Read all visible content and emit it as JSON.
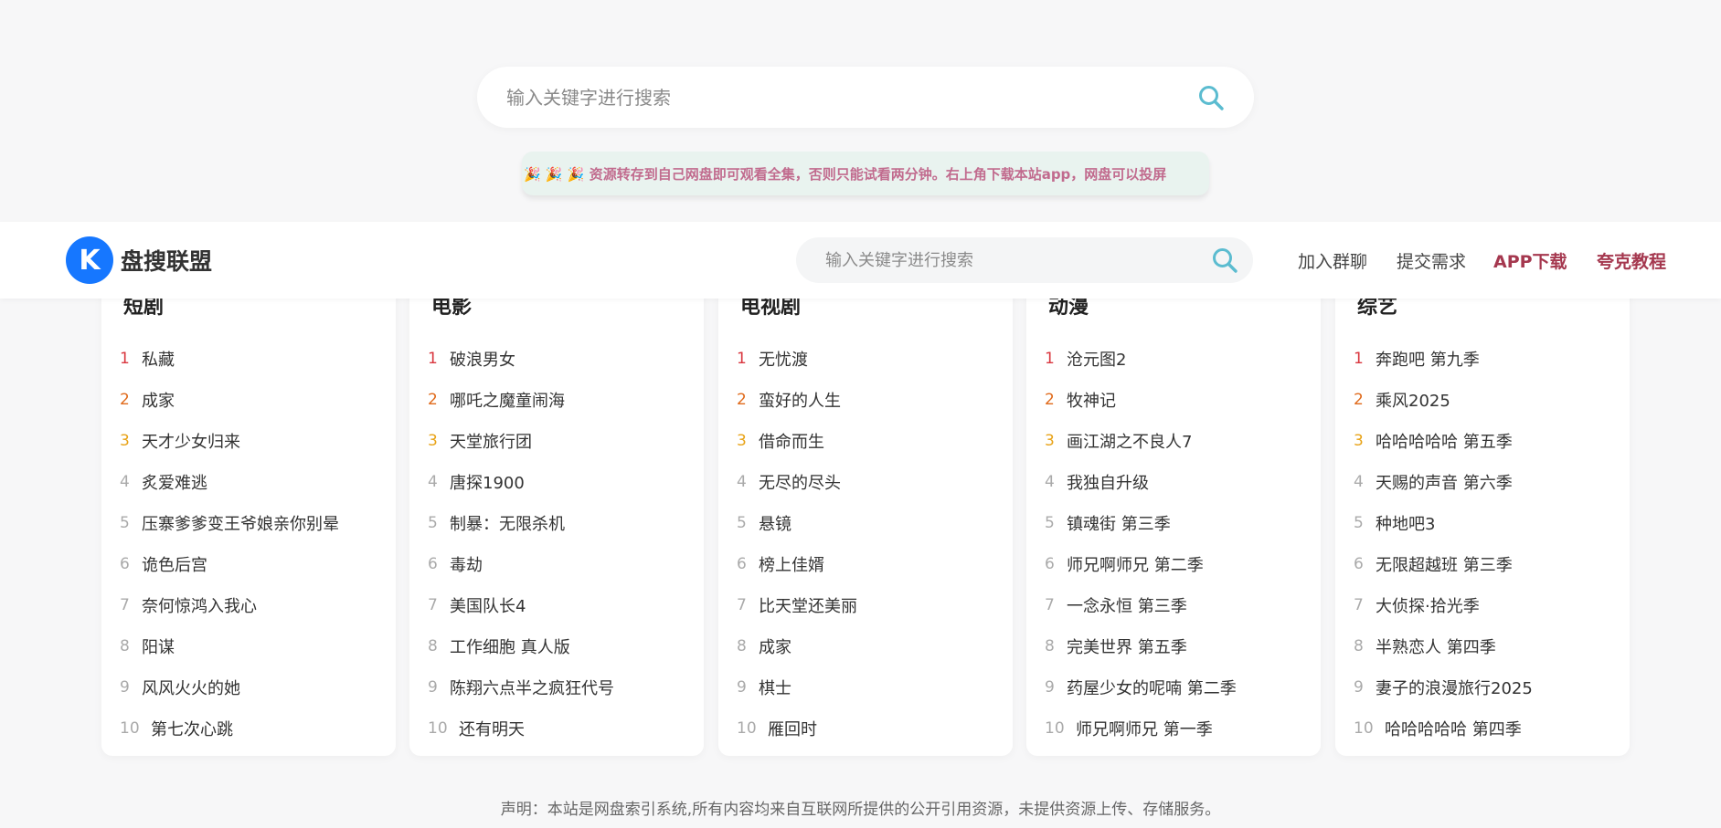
{
  "search": {
    "placeholder": "输入关键字进行搜索"
  },
  "notice": {
    "text": "🎉 🎉 🎉 资源转存到自己网盘即可观看全集，否则只能试看两分钟。右上角下载本站app，网盘可以投屏"
  },
  "header": {
    "logo_letter": "K",
    "site_name": "盘搜联盟",
    "search_placeholder": "输入关键字进行搜索",
    "nav": [
      "加入群聊",
      "提交需求",
      "APP下载",
      "夸克教程"
    ]
  },
  "categories": [
    {
      "title": "短剧",
      "items": [
        "私藏",
        "成家",
        "天才少女归来",
        "炙爱难逃",
        "压寨爹爹变王爷娘亲你别晕",
        "诡色后宫",
        "奈何惊鸿入我心",
        "阳谋",
        "风风火火的她",
        "第七次心跳"
      ]
    },
    {
      "title": "电影",
      "items": [
        "破浪男女",
        "哪吒之魔童闹海",
        "天堂旅行团",
        "唐探1900",
        "制暴：无限杀机",
        "毒劫",
        "美国队长4",
        "工作细胞 真人版",
        "陈翔六点半之疯狂代号",
        "还有明天"
      ]
    },
    {
      "title": "电视剧",
      "items": [
        "无忧渡",
        "蛮好的人生",
        "借命而生",
        "无尽的尽头",
        "悬镜",
        "榜上佳婿",
        "比天堂还美丽",
        "成家",
        "棋士",
        "雁回时"
      ]
    },
    {
      "title": "动漫",
      "items": [
        "沧元图2",
        "牧神记",
        "画江湖之不良人7",
        "我独自升级",
        "镇魂街 第三季",
        "师兄啊师兄 第二季",
        "一念永恒 第三季",
        "完美世界 第五季",
        "药屋少女的呢喃 第二季",
        "师兄啊师兄 第一季"
      ]
    },
    {
      "title": "综艺",
      "items": [
        "奔跑吧 第九季",
        "乘风2025",
        "哈哈哈哈哈 第五季",
        "天赐的声音 第六季",
        "种地吧3",
        "无限超越班 第三季",
        "大侦探·拾光季",
        "半熟恋人 第四季",
        "妻子的浪漫旅行2025",
        "哈哈哈哈哈 第四季"
      ]
    }
  ],
  "footer": {
    "text": "声明：本站是网盘索引系统,所有内容均来自互联网所提供的公开引用资源，未提供资源上传、存储服务。"
  },
  "colors": {
    "accent": "#a5384f",
    "brand": "#1677ff",
    "search_icon": "#5bbcd0"
  }
}
